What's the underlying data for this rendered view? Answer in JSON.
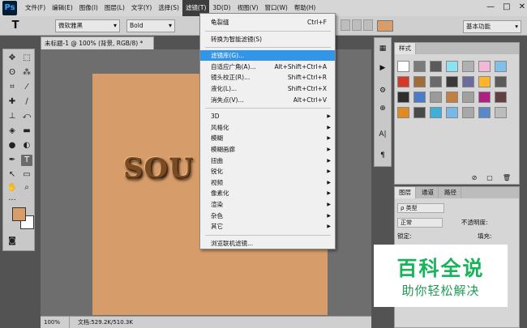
{
  "app": {
    "logo": "Ps"
  },
  "menubar": {
    "items": [
      "文件(F)",
      "编辑(E)",
      "图像(I)",
      "图层(L)",
      "文字(Y)",
      "选择(S)",
      "滤镜(T)",
      "3D(D)",
      "视图(V)",
      "窗口(W)",
      "帮助(H)"
    ],
    "active_index": 6,
    "window_controls": [
      "—",
      "□",
      "✕"
    ]
  },
  "options": {
    "tool_glyph": "T",
    "font_family": "微软雅黑",
    "font_style": "Bold",
    "swatch_color": "#d99d6a",
    "workspace": "基本功能"
  },
  "document": {
    "tab_title": "未标题-1 @ 100% (背景, RGB/8) *",
    "canvas_text": "SOU",
    "canvas_color": "#d69c69",
    "zoom": "100%",
    "doc_info": "文档:529.2K/510.3K"
  },
  "tools": {
    "foreground": "#d99d6a",
    "background": "#ffffff",
    "glyphs": {
      "move": "✥",
      "marquee": "⬚",
      "lasso": "ʘ",
      "magic": "⁂",
      "crop": "⌗",
      "eyedrop": "⁄",
      "heal": "✚",
      "brush": "∕",
      "stamp": "⊥",
      "history": "⤺",
      "eraser": "◈",
      "gradient": "▬",
      "blur": "●",
      "dodge": "◐",
      "pen": "✒",
      "type": "T",
      "path": "↖",
      "shape": "▭",
      "hand": "✋",
      "zoom": "⌕",
      "more": "···",
      "mode": "◙"
    }
  },
  "filter_menu": {
    "items": [
      {
        "label": "龟裂缝",
        "shortcut": "Ctrl+F",
        "type": "item"
      },
      {
        "type": "sep"
      },
      {
        "label": "转换为智能滤镜(S)",
        "type": "item"
      },
      {
        "type": "sep"
      },
      {
        "label": "滤镜库(G)...",
        "type": "item",
        "highlighted": true
      },
      {
        "label": "自适应广角(A)...",
        "shortcut": "Alt+Shift+Ctrl+A",
        "type": "item"
      },
      {
        "label": "镜头校正(R)...",
        "shortcut": "Shift+Ctrl+R",
        "type": "item"
      },
      {
        "label": "液化(L)...",
        "shortcut": "Shift+Ctrl+X",
        "type": "item"
      },
      {
        "label": "消失点(V)...",
        "shortcut": "Alt+Ctrl+V",
        "type": "item"
      },
      {
        "type": "sep"
      },
      {
        "label": "3D",
        "type": "sub"
      },
      {
        "label": "风格化",
        "type": "sub"
      },
      {
        "label": "模糊",
        "type": "sub"
      },
      {
        "label": "模糊画廊",
        "type": "sub"
      },
      {
        "label": "扭曲",
        "type": "sub"
      },
      {
        "label": "锐化",
        "type": "sub"
      },
      {
        "label": "视频",
        "type": "sub"
      },
      {
        "label": "像素化",
        "type": "sub"
      },
      {
        "label": "渲染",
        "type": "sub"
      },
      {
        "label": "杂色",
        "type": "sub"
      },
      {
        "label": "其它",
        "type": "sub"
      },
      {
        "type": "sep"
      },
      {
        "label": "浏览联机滤镜...",
        "type": "item"
      }
    ]
  },
  "styles_panel": {
    "tab": "样式",
    "swatches": [
      "#ffffff",
      "#7a7a7a",
      "#5a5a5a",
      "#8fe0f0",
      "#b0b0b0",
      "#f2b8d8",
      "#7fbfe8",
      "#d6382a",
      "#a06d3a",
      "#6a6a6a",
      "#3a3a3a",
      "#6c6c9c",
      "#ffb42a",
      "#5a5a5a",
      "#2e2e2e",
      "#4c7cc8",
      "#9a9a9a",
      "#c08040",
      "#a0a0a0",
      "#b02080",
      "#604040",
      "#e08a20",
      "#4a4a4a",
      "#3cb0d8",
      "#78b8e8",
      "#a8a8a8",
      "#5888c8",
      "#bcbcbc"
    ],
    "footer_icons": [
      "⊘",
      "▢",
      "🗑"
    ]
  },
  "layers_panel": {
    "tabs": [
      "图层",
      "通道",
      "路径"
    ],
    "filter_kind": "ρ 类型",
    "blend_mode": "正常",
    "opacity_label": "不透明度:",
    "lock_label": "锁定:",
    "fill_label": "填充:"
  },
  "right_icons": [
    "▦",
    "▶",
    "⚙",
    "⊕",
    "A|",
    "¶"
  ],
  "watermark": {
    "title": "百科全说",
    "subtitle": "助你轻松解决"
  }
}
